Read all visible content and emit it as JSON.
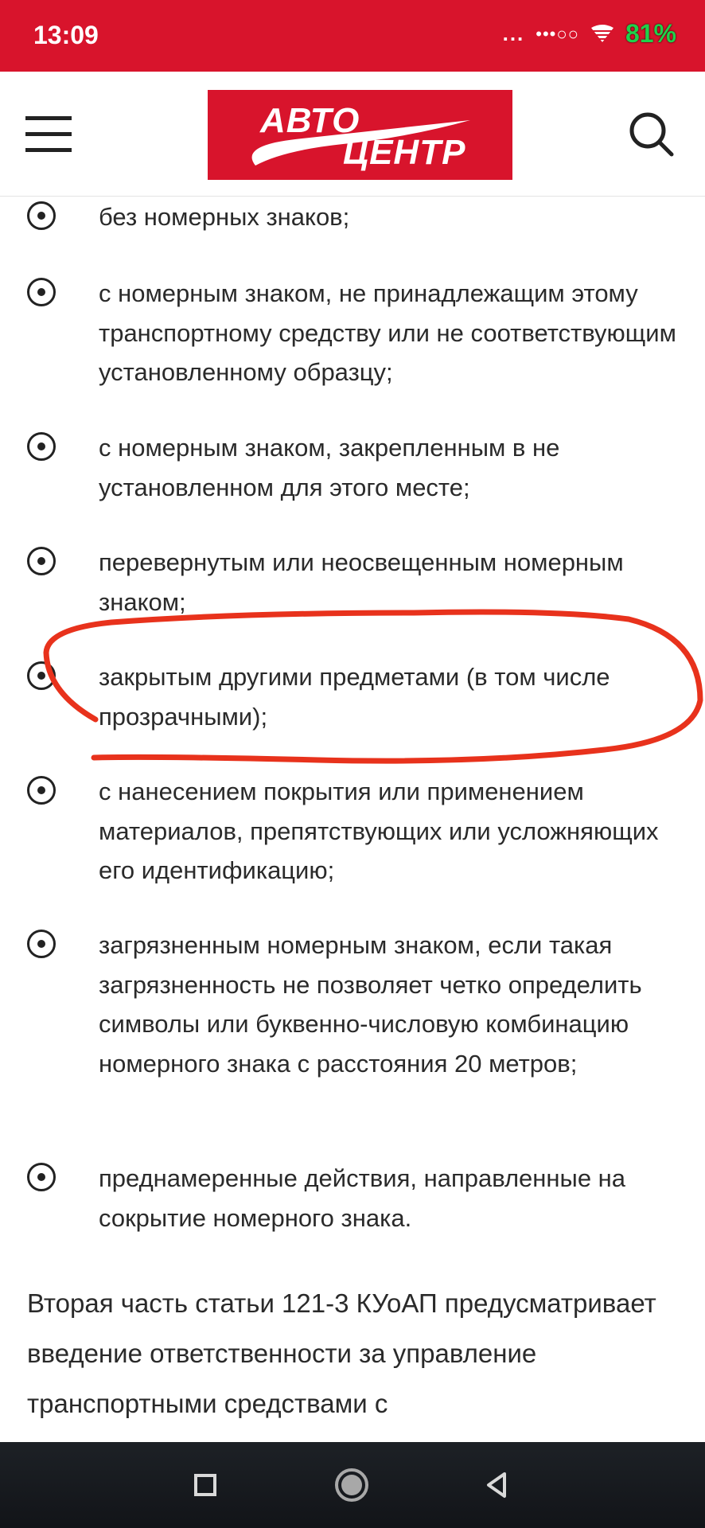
{
  "status_bar": {
    "time": "13:09",
    "dots": "...",
    "signal": "•••○○",
    "battery": "81%",
    "icons": [
      "wifi-icon"
    ]
  },
  "header": {
    "logo": {
      "line1": "АВТО",
      "line2": "ЦЕНТР"
    },
    "icons": [
      "menu-icon",
      "search-icon"
    ]
  },
  "bullets": [
    "без номерных знаков;",
    "с номерным знаком, не принадлежащим этому транспортному средству или не соответствующим установленному образцу;",
    "с номерным знаком, закрепленным в не установленном для этого месте;",
    "перевернутым или неосвещенным номерным знаком;",
    "закрытым другими предметами (в том числе прозрачными);",
    "с нанесением покрытия или применением материалов, препятствующих или усложняющих его идентификацию;",
    "загрязненным номерным знаком, если такая загрязненность не позволяет четко определить символы или буквенно-числовую комбинацию номерного знака с расстояния 20 метров;",
    "преднамеренные действия, направленные на сокрытие номерного знака."
  ],
  "paragraph": "Вторая часть статьи 121-3 КУоАП предусматривает введение ответственности за управление транспортными средствами с",
  "annotation_color": "#e8321c",
  "nav": {
    "icons": [
      "recents-square-icon",
      "home-circle-icon",
      "back-triangle-icon"
    ]
  },
  "colors": {
    "brand_red": "#d8142c",
    "text": "#2a2a2a"
  }
}
